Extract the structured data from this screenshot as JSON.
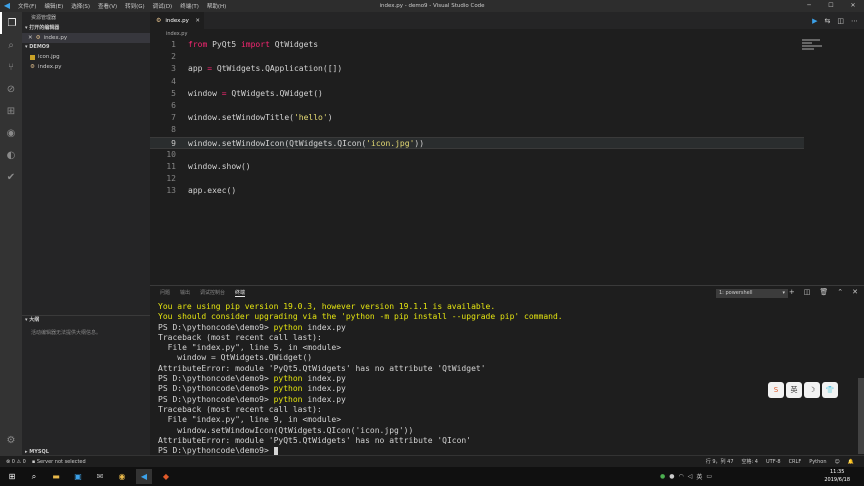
{
  "window": {
    "title": "index.py - demo9 - Visual Studio Code",
    "menu": [
      "文件(F)",
      "编辑(E)",
      "选择(S)",
      "查看(V)",
      "转到(G)",
      "调试(D)",
      "终端(T)",
      "帮助(H)"
    ]
  },
  "sidebar": {
    "header": "资源管理器",
    "open_editors_title": "打开的编辑器",
    "open_editor_item": "index.py",
    "folder_title": "DEMO9",
    "files": [
      "icon.jpg",
      "index.py"
    ],
    "outline_title": "大纲",
    "outline_empty": "活动编辑器无法提供大纲信息。",
    "mysql_title": "MYSQL"
  },
  "editor": {
    "tab_label": "index.py",
    "breadcrumb": "index.py",
    "current_line": 9,
    "lines": [
      {
        "n": "1",
        "tokens": [
          {
            "t": "from",
            "c": "kw"
          },
          {
            "t": " PyQt5 ",
            "c": "pl"
          },
          {
            "t": "import",
            "c": "kw"
          },
          {
            "t": " QtWidgets",
            "c": "pl"
          }
        ]
      },
      {
        "n": "2",
        "tokens": []
      },
      {
        "n": "3",
        "tokens": [
          {
            "t": "app ",
            "c": "pl"
          },
          {
            "t": "=",
            "c": "op"
          },
          {
            "t": " QtWidgets.QApplication([])",
            "c": "pl"
          }
        ]
      },
      {
        "n": "4",
        "tokens": []
      },
      {
        "n": "5",
        "tokens": [
          {
            "t": "window ",
            "c": "pl"
          },
          {
            "t": "=",
            "c": "op"
          },
          {
            "t": " QtWidgets.QWidget()",
            "c": "pl"
          }
        ]
      },
      {
        "n": "6",
        "tokens": []
      },
      {
        "n": "7",
        "tokens": [
          {
            "t": "window.setWindowTitle(",
            "c": "pl"
          },
          {
            "t": "'hello'",
            "c": "st"
          },
          {
            "t": ")",
            "c": "pl"
          }
        ]
      },
      {
        "n": "8",
        "tokens": []
      },
      {
        "n": "9",
        "tokens": [
          {
            "t": "window.setWindowIcon(QtWidgets.QIcon(",
            "c": "pl"
          },
          {
            "t": "'icon.jpg'",
            "c": "st"
          },
          {
            "t": "))",
            "c": "pl"
          }
        ]
      },
      {
        "n": "10",
        "tokens": []
      },
      {
        "n": "11",
        "tokens": [
          {
            "t": "window.show()",
            "c": "pl"
          }
        ]
      },
      {
        "n": "12",
        "tokens": []
      },
      {
        "n": "13",
        "tokens": [
          {
            "t": "app.exec()",
            "c": "pl"
          }
        ]
      }
    ]
  },
  "panel": {
    "tabs": [
      "问题",
      "输出",
      "调试控制台",
      "终端"
    ],
    "active_tab": "终端",
    "terminal_select": "1: powershell",
    "terminal_lines": [
      {
        "kind": "warn",
        "text": "You are using pip version 19.0.3, however version 19.1.1 is available."
      },
      {
        "kind": "warn",
        "text": "You should consider upgrading via the 'python -m pip install --upgrade pip' command."
      },
      {
        "kind": "prompt",
        "prompt": "PS D:\\pythoncode\\demo9> ",
        "cmd": "python",
        "rest": " index.py"
      },
      {
        "kind": "plain",
        "text": "Traceback (most recent call last):"
      },
      {
        "kind": "plain",
        "text": "  File \"index.py\", line 5, in <module>"
      },
      {
        "kind": "plain",
        "text": "    window = QtWidgets.QWidget()"
      },
      {
        "kind": "plain",
        "text": "AttributeError: module 'PyQt5.QtWidgets' has no attribute 'QtWidget'"
      },
      {
        "kind": "prompt",
        "prompt": "PS D:\\pythoncode\\demo9> ",
        "cmd": "python",
        "rest": " index.py"
      },
      {
        "kind": "prompt",
        "prompt": "PS D:\\pythoncode\\demo9> ",
        "cmd": "python",
        "rest": " index.py"
      },
      {
        "kind": "prompt",
        "prompt": "PS D:\\pythoncode\\demo9> ",
        "cmd": "python",
        "rest": " index.py"
      },
      {
        "kind": "plain",
        "text": "Traceback (most recent call last):"
      },
      {
        "kind": "plain",
        "text": "  File \"index.py\", line 9, in <module>"
      },
      {
        "kind": "plain",
        "text": "    window.setWindowIcon(QtWidgets.QIcon('icon.jpg'))"
      },
      {
        "kind": "plain",
        "text": "AttributeError: module 'PyQt5.QtWidgets' has no attribute 'QIcon'"
      },
      {
        "kind": "cursor",
        "prompt": "PS D:\\pythoncode\\demo9> "
      }
    ]
  },
  "statusbar": {
    "errors": "0",
    "warnings": "0",
    "server": "Server not selected",
    "position": "行 9，列 47",
    "spaces": "空格: 4",
    "encoding": "UTF-8",
    "eol": "CRLF",
    "language": "Python"
  },
  "taskbar": {
    "time": "11:35",
    "date": "2019/6/18"
  },
  "ime": [
    "S",
    "英",
    "☽",
    "👕"
  ]
}
